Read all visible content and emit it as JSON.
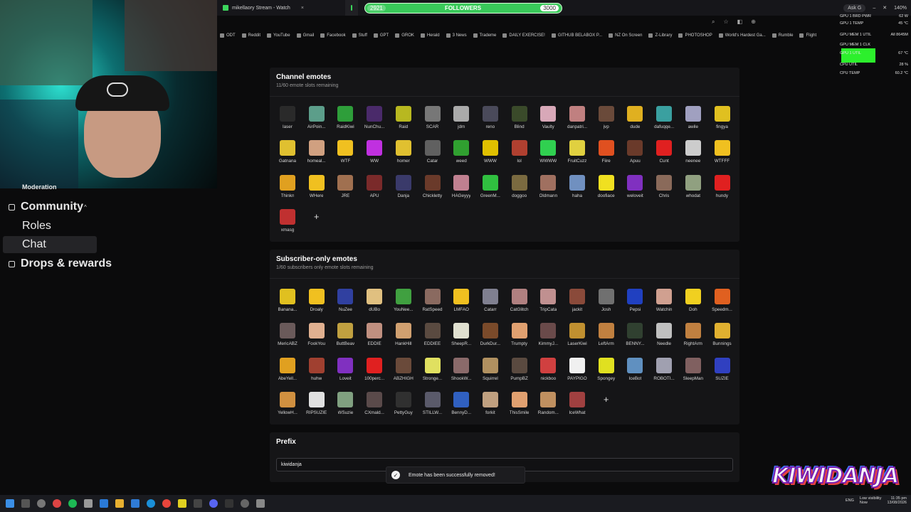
{
  "browser": {
    "tabs": [
      {
        "label": "mikellaory Stream - Watch",
        "close": "×",
        "active": false
      },
      {
        "label": "",
        "close": "×",
        "active": true
      }
    ],
    "followers": {
      "label": "FOLLOWERS",
      "current": "2921",
      "goal": "3000",
      "progress": 0.974
    },
    "ask": "Ask G",
    "zoom": "140%",
    "bookmarks": [
      "ODT",
      "Reddit",
      "YouTube",
      "Gmail",
      "Facebook",
      "Stuff",
      "GPT",
      "GROK",
      "Herald",
      "3 News",
      "Trademe",
      "DAILY EXERCISE!",
      "GITHUB BELABOX P...",
      "NZ On Screen",
      "Z-Library",
      "PHOTOSHOP",
      "World's Hardest Ga...",
      "Rumble",
      "Flight"
    ]
  },
  "sidebar": {
    "moderation": "Moderation",
    "community": "Community",
    "chevron": "^",
    "roles": "Roles",
    "chat": "Chat",
    "drops": "Drops & rewards"
  },
  "channel": {
    "title": "Channel emotes",
    "subtitle": "11/60 emote slots remaining",
    "add": "+",
    "emotes": [
      {
        "name": "laser",
        "color": "#2a2a2a"
      },
      {
        "name": "AirPoin...",
        "color": "#5c9e8a"
      },
      {
        "name": "RaidKiwi",
        "color": "#2e9e3a"
      },
      {
        "name": "NunChu...",
        "color": "#4a2a6a"
      },
      {
        "name": "Raid",
        "color": "#b8b820"
      },
      {
        "name": "SCAR",
        "color": "#777777"
      },
      {
        "name": "jdm",
        "color": "#aaaaaa"
      },
      {
        "name": "reno",
        "color": "#4a4a5a"
      },
      {
        "name": "Blind",
        "color": "#3a4a2a"
      },
      {
        "name": "Vaulty",
        "color": "#d8a8b8"
      },
      {
        "name": "danpatri...",
        "color": "#c08080"
      },
      {
        "name": "jvp",
        "color": "#6a4a3a"
      },
      {
        "name": "dude",
        "color": "#e0b020"
      },
      {
        "name": "dafuqqe...",
        "color": "#3aa0a0"
      },
      {
        "name": "awile",
        "color": "#a0a0c0"
      },
      {
        "name": "fingya",
        "color": "#e0c020"
      },
      {
        "name": "Gatnana",
        "color": "#e0c030"
      },
      {
        "name": "homeal...",
        "color": "#d0a080"
      },
      {
        "name": "WTF",
        "color": "#f0c020"
      },
      {
        "name": "WW",
        "color": "#c030e0"
      },
      {
        "name": "homer",
        "color": "#e0c030"
      },
      {
        "name": "Catar",
        "color": "#606060"
      },
      {
        "name": "weed",
        "color": "#30a030"
      },
      {
        "name": "WWW",
        "color": "#e0c000"
      },
      {
        "name": "lol",
        "color": "#b04030"
      },
      {
        "name": "WWWW",
        "color": "#30d050"
      },
      {
        "name": "FruitCuzz",
        "color": "#e0d040"
      },
      {
        "name": "Fiire",
        "color": "#e05020"
      },
      {
        "name": "Apuu",
        "color": "#6a3a2a"
      },
      {
        "name": "Cunt",
        "color": "#e02020"
      },
      {
        "name": "neenee",
        "color": "#cccccc"
      },
      {
        "name": "WTFFF",
        "color": "#f0c020"
      },
      {
        "name": "Thinkn",
        "color": "#e0a020"
      },
      {
        "name": "WHere",
        "color": "#f0c020"
      },
      {
        "name": "JRE",
        "color": "#a07050"
      },
      {
        "name": "APU",
        "color": "#7a2a2a"
      },
      {
        "name": "Danja",
        "color": "#3a3a6a"
      },
      {
        "name": "Chickletty",
        "color": "#6a3a2a"
      },
      {
        "name": "HAGeyyy",
        "color": "#c08090"
      },
      {
        "name": "GreenM...",
        "color": "#30c040"
      },
      {
        "name": "doggoo",
        "color": "#7a6a40"
      },
      {
        "name": "Oldmann",
        "color": "#a07060"
      },
      {
        "name": "haha",
        "color": "#7090c0"
      },
      {
        "name": "doofiace",
        "color": "#f0e020"
      },
      {
        "name": "weloveit",
        "color": "#8030c0"
      },
      {
        "name": "Chris",
        "color": "#8a6a5a"
      },
      {
        "name": "whodat",
        "color": "#90a080"
      },
      {
        "name": "hundy",
        "color": "#e02020"
      },
      {
        "name": "xmasg",
        "color": "#c03030"
      }
    ]
  },
  "subscriber": {
    "title": "Subscriber-only emotes",
    "subtitle": "1/60 subscribers only emote slots remaining",
    "add": "+",
    "emotes": [
      {
        "name": "Banana...",
        "color": "#e0c020"
      },
      {
        "name": "Droaly",
        "color": "#f0c020"
      },
      {
        "name": "NuZee",
        "color": "#3040a0"
      },
      {
        "name": "dUBo",
        "color": "#e0c080"
      },
      {
        "name": "YouNee...",
        "color": "#40a040"
      },
      {
        "name": "RatSpeed",
        "color": "#8a6a60"
      },
      {
        "name": "LMFAO",
        "color": "#f0c020"
      },
      {
        "name": "Catarr",
        "color": "#808090"
      },
      {
        "name": "CatGlitch",
        "color": "#b08080"
      },
      {
        "name": "TripCata",
        "color": "#c09090"
      },
      {
        "name": "jackit",
        "color": "#8a4a3a"
      },
      {
        "name": "Josh",
        "color": "#707070"
      },
      {
        "name": "Pepsi",
        "color": "#2040c0"
      },
      {
        "name": "Watchin",
        "color": "#d0a090"
      },
      {
        "name": "Doh",
        "color": "#f0d020"
      },
      {
        "name": "Speedm...",
        "color": "#e06020"
      },
      {
        "name": "MericABZ",
        "color": "#6a5a5a"
      },
      {
        "name": "FookYou",
        "color": "#e0b090"
      },
      {
        "name": "ButtBeav",
        "color": "#c0a040"
      },
      {
        "name": "EDDIE",
        "color": "#c09080"
      },
      {
        "name": "HankHill",
        "color": "#d0a070"
      },
      {
        "name": "EDDIEE",
        "color": "#5a4a40"
      },
      {
        "name": "SheepR...",
        "color": "#e0e0d0"
      },
      {
        "name": "DurkDur...",
        "color": "#7a4a2a"
      },
      {
        "name": "Trumpty",
        "color": "#e0a070"
      },
      {
        "name": "KimmyJ...",
        "color": "#6a4a4a"
      },
      {
        "name": "LaserKiwi",
        "color": "#c09030"
      },
      {
        "name": "LeftArm",
        "color": "#c08040"
      },
      {
        "name": "BENNY...",
        "color": "#304030"
      },
      {
        "name": "Needle",
        "color": "#c0c0c0"
      },
      {
        "name": "RightArm",
        "color": "#c08040"
      },
      {
        "name": "Bunnings",
        "color": "#e0b030"
      },
      {
        "name": "AbeYell...",
        "color": "#e0a020"
      },
      {
        "name": "huhw",
        "color": "#a04030"
      },
      {
        "name": "Loveit",
        "color": "#8030c0"
      },
      {
        "name": "100perc...",
        "color": "#e02020"
      },
      {
        "name": "ABZHIGH",
        "color": "#6a4a3a"
      },
      {
        "name": "Stronge...",
        "color": "#e0e060"
      },
      {
        "name": "ShookW...",
        "color": "#8a6a6a"
      },
      {
        "name": "Squirrel",
        "color": "#b09060"
      },
      {
        "name": "PumpBZ",
        "color": "#5a4a40"
      },
      {
        "name": "nickboo",
        "color": "#d04040"
      },
      {
        "name": "PAYPIGO",
        "color": "#f0f0f0"
      },
      {
        "name": "Spongey",
        "color": "#e0e020"
      },
      {
        "name": "IceBot",
        "color": "#6090c0"
      },
      {
        "name": "ROBOTI...",
        "color": "#a0a0b0"
      },
      {
        "name": "SleepMan",
        "color": "#806060"
      },
      {
        "name": "SUZIE",
        "color": "#3040c0"
      },
      {
        "name": "YellowH...",
        "color": "#d09040"
      },
      {
        "name": "RIPSUZIE",
        "color": "#e0e0e0"
      },
      {
        "name": "WSuzie",
        "color": "#80a080"
      },
      {
        "name": "CXmald...",
        "color": "#5a4a4a"
      },
      {
        "name": "PettyGuy",
        "color": "#303030"
      },
      {
        "name": "STILLW...",
        "color": "#5a5a6a"
      },
      {
        "name": "BennyD...",
        "color": "#3060c0"
      },
      {
        "name": "forkit",
        "color": "#c0a080"
      },
      {
        "name": "ThisSmile",
        "color": "#e0a070"
      },
      {
        "name": "Random...",
        "color": "#c09060"
      },
      {
        "name": "IceWhat",
        "color": "#a04040"
      }
    ]
  },
  "prefix": {
    "title": "Prefix",
    "value": "kiwidanja"
  },
  "toast": {
    "check": "✓",
    "message": "Emote has been successfully removed!"
  },
  "stats": {
    "rows": [
      {
        "label": "GPU 1 BRD PWR",
        "value": "62 W"
      },
      {
        "label": "GPU 1 TEMP",
        "value": "45 °C"
      },
      {
        "label": "GPU MEM 1 UTIL",
        "value": "All 8645M"
      },
      {
        "label": "GPU MEM 1 CLK",
        "value": ""
      },
      {
        "label": "GPU 1 UTIL",
        "value": "67 °C"
      },
      {
        "label": "CPU UTIL",
        "value": "28 %"
      },
      {
        "label": "CPU TEMP",
        "value": "60.2 °C"
      }
    ]
  },
  "logo": "KIWIDANJA",
  "tray": {
    "visibility": "Low visibility",
    "visibility_sub": "Now",
    "time": "11:35 pm",
    "date": "13/08/2026",
    "lang": "ENG"
  }
}
